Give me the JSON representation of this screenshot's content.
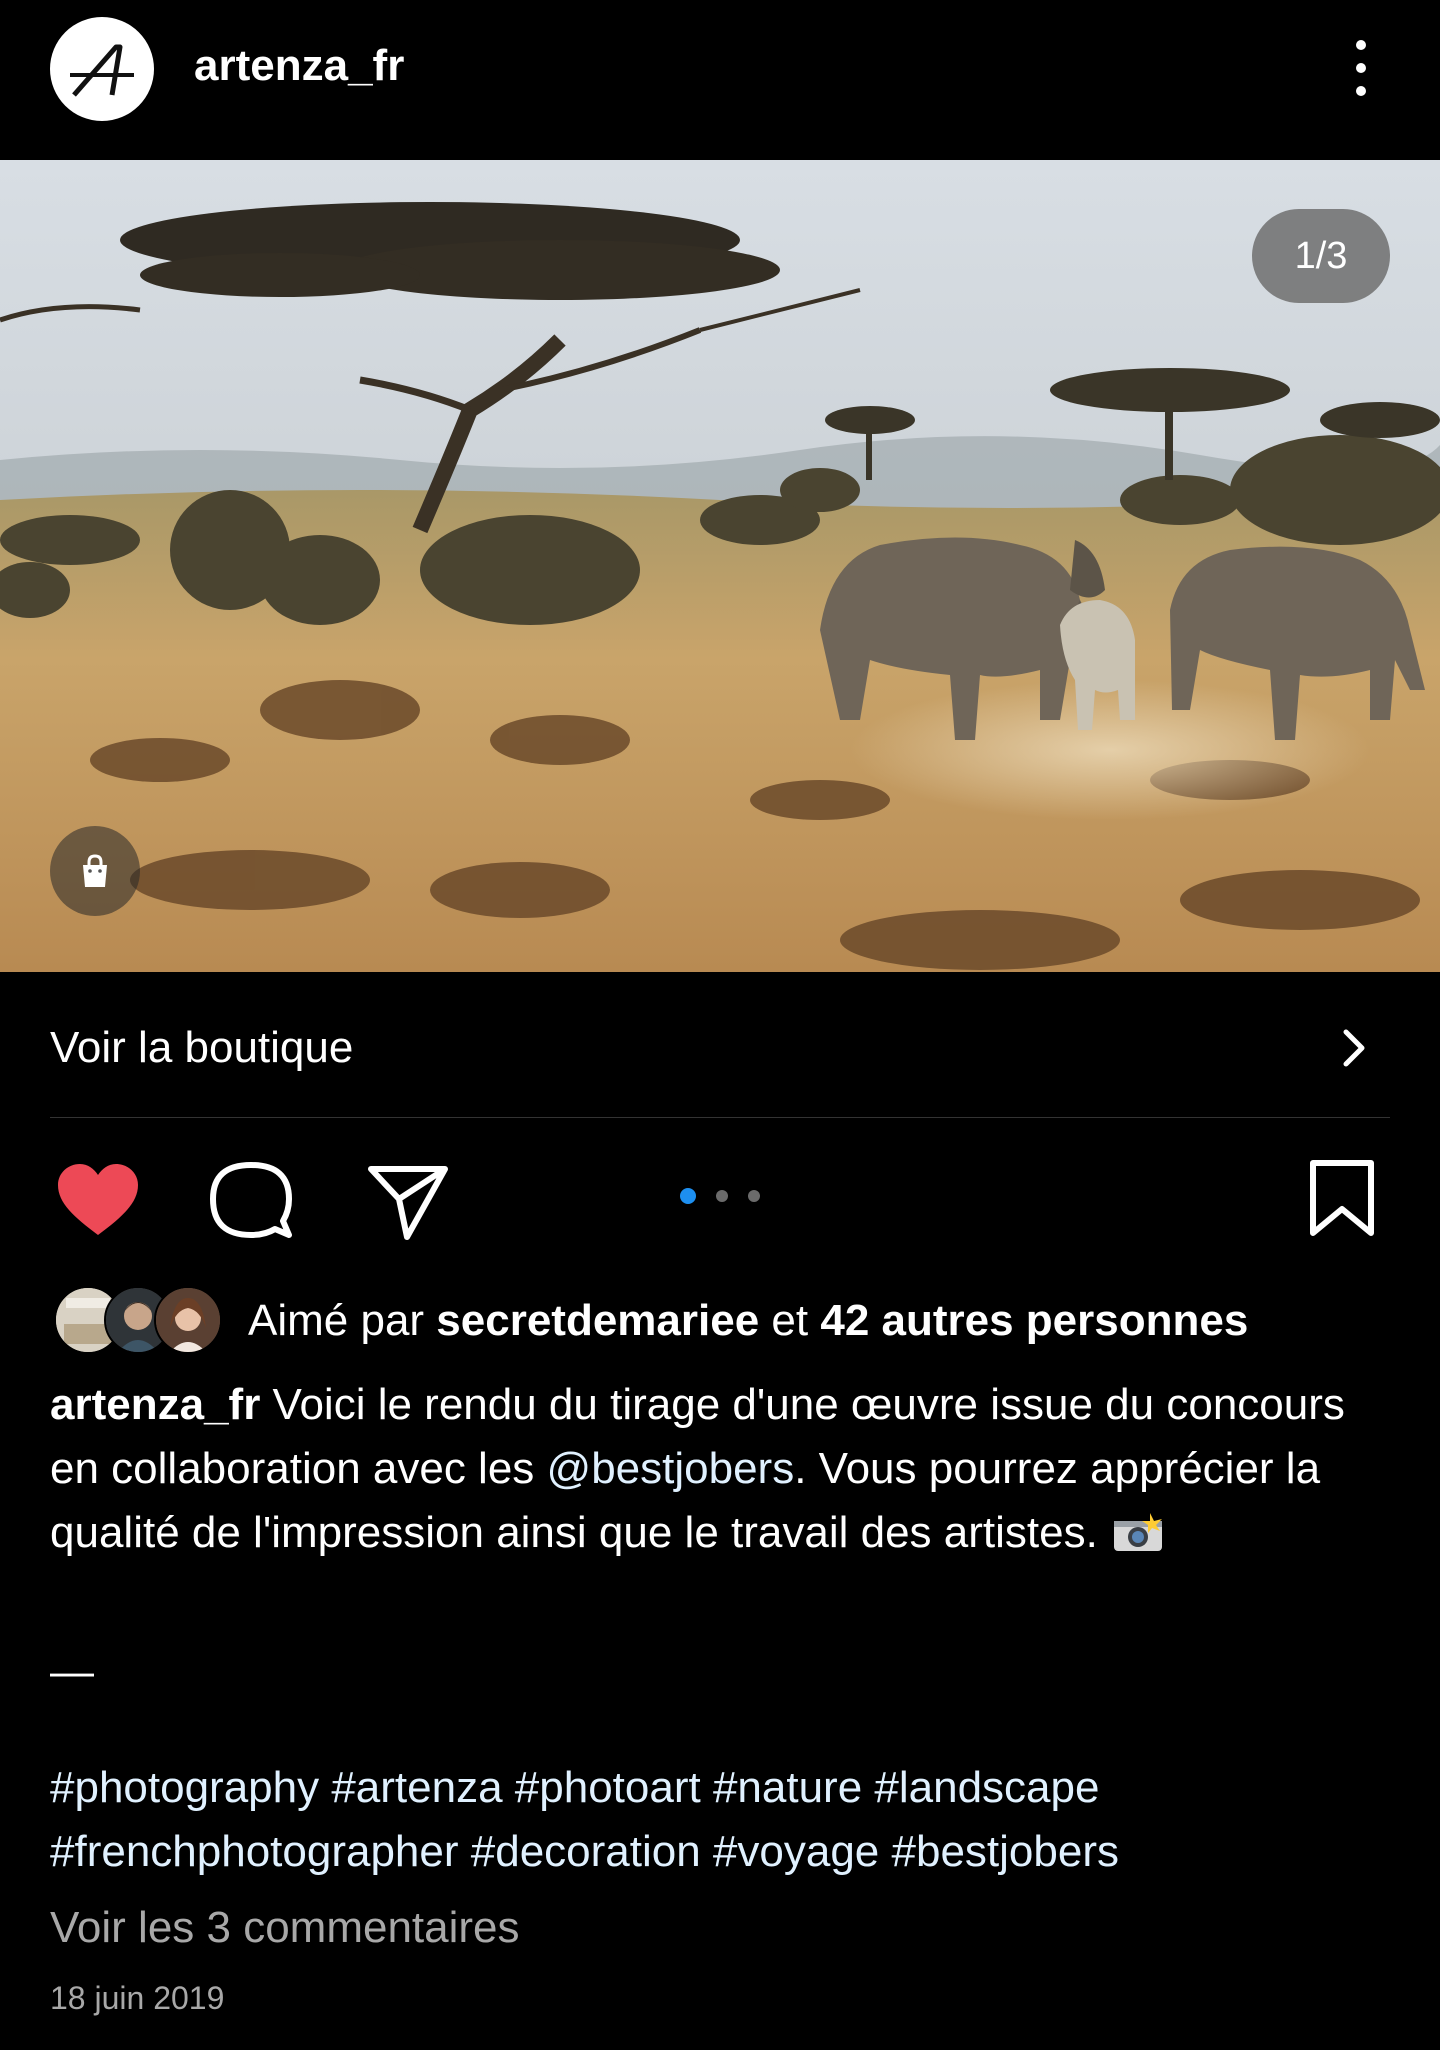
{
  "header": {
    "username": "artenza_fr",
    "avatar_icon": "artenza-logo-icon",
    "more_icon": "more-options-icon"
  },
  "media": {
    "counter": "1/3",
    "description_icon": "shopping-bag-icon"
  },
  "shop": {
    "label": "Voir la boutique",
    "chevron_icon": "chevron-right-icon"
  },
  "actions": {
    "like_icon": "heart-filled-icon",
    "comment_icon": "comment-icon",
    "share_icon": "send-icon",
    "save_icon": "bookmark-icon",
    "carousel_total": 3,
    "carousel_active": 1,
    "like_color": "#ed4956",
    "dot_active_color": "#1d8ff0"
  },
  "likes": {
    "prefix": "Aimé par ",
    "user": "secretdemariee",
    "middle": " et ",
    "others": "42 autres personnes"
  },
  "caption": {
    "user": "artenza_fr",
    "text_1": " Voici le rendu du tirage d'une œuvre issue du concours en collaboration avec les ",
    "mention": "@bestjobers",
    "text_2": ". Vous pourrez apprécier la qualité de l'impression ainsi que le travail des artistes. ",
    "emoji_icon": "camera-flash-emoji",
    "dash": "—",
    "hashtags": "#photography #artenza #photoart #nature #landscape #frenchphotographer #decoration #voyage #bestjobers"
  },
  "comments": {
    "view_label": "Voir les 3 commentaires"
  },
  "date": "18 juin 2019"
}
